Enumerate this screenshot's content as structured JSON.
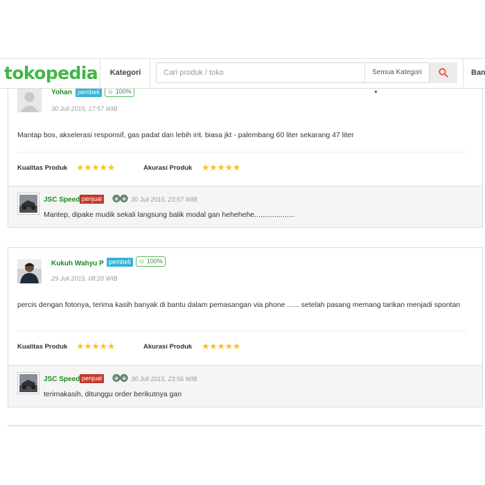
{
  "header": {
    "logo": "tokopedia",
    "kategori_label": "Kategori",
    "search_placeholder": "Cari produk / toko",
    "category_select": "Semua Kategori",
    "bantuan_label": "Ban"
  },
  "reviews": [
    {
      "username": "Yohan",
      "role": "pembeli",
      "reputation": "100%",
      "date": "30 Juli 2015, 17:57 WIB",
      "text": "Mantap bos, akselerasi responsif, gas padat dan lebih irit. biasa jkt - palembang 60 liter sekarang 47 liter",
      "kualitas_label": "Kualitas Produk",
      "kualitas_stars": "★★★★★",
      "kualitas_rating": 5,
      "akurasi_label": "Akurasi Produk",
      "akurasi_stars": "★★★★★",
      "akurasi_rating": 5,
      "reply": {
        "seller_name": "JSC Speed",
        "seller_role": "penjual",
        "date": "30 Juli 2015, 23:57 WIB",
        "text": "Mantep, dipake mudik sekali langsung balik modal gan hehehehe...................."
      }
    },
    {
      "username": "Kukuh Wahyu P",
      "role": "pembeli",
      "reputation": "100%",
      "date": "29 Juli 2015, 08:20 WIB",
      "text": "percis dengan fotonya, terima kasih banyak di bantu dalam pemasangan via phone ...... setelah pasang memang tarikan menjadi spontan",
      "kualitas_label": "Kualitas Produk",
      "kualitas_stars": "★★★★★",
      "kualitas_rating": 5,
      "akurasi_label": "Akurasi Produk",
      "akurasi_stars": "★★★★★",
      "akurasi_rating": 5,
      "reply": {
        "seller_name": "JSC Speed",
        "seller_role": "penjual",
        "date": "30 Juli 2015, 23:56 WIB",
        "text": "terimakasih, ditunggu order berikutnya gan"
      }
    }
  ],
  "colors": {
    "brand_green": "#42b549",
    "buyer_badge": "#36b3d6",
    "seller_badge": "#c0392b",
    "star": "#f5c423",
    "search_icon": "#e74c3c"
  },
  "icons": {
    "search": "search-icon",
    "smile": "smile-icon",
    "medal": "medal-icon",
    "caret": "caret-down-icon"
  }
}
